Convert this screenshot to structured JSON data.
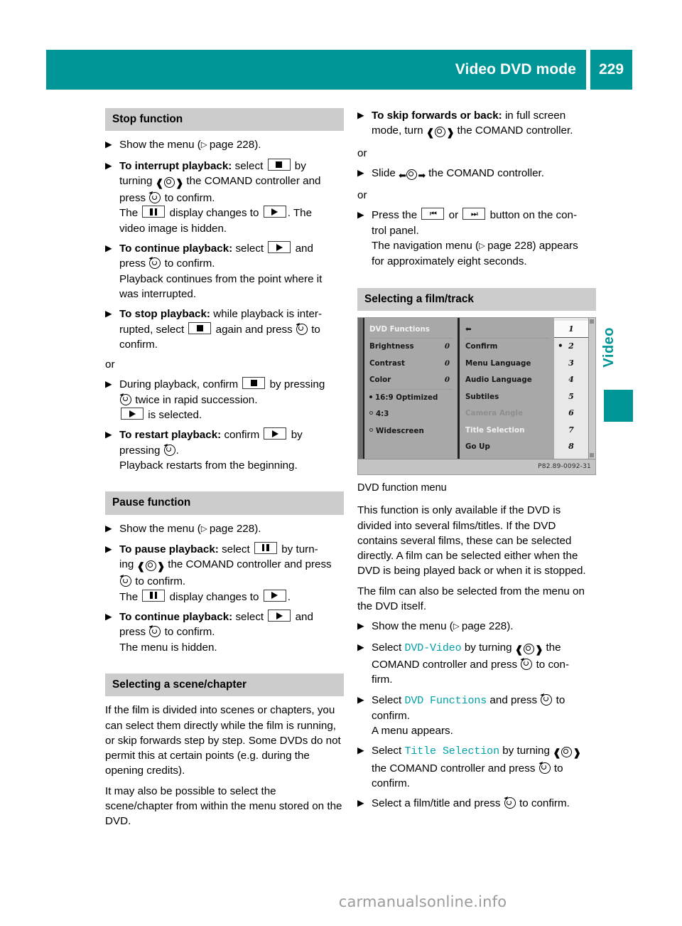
{
  "header": {
    "title": "Video DVD mode",
    "page_number": "229",
    "accent_color": "#009597"
  },
  "side_tab": {
    "label": "Video"
  },
  "left_column": {
    "sections": [
      {
        "heading": "Stop function",
        "blocks": [
          {
            "kind": "step",
            "id": "show-menu-1",
            "text_pre": "Show the menu (",
            "page_ref": "page 228",
            "text_post": ")."
          },
          {
            "kind": "step",
            "id": "interrupt-playback",
            "bold": "To interrupt playback:",
            "l1a": "select",
            "icon1": "stop-button",
            "l1b": "by",
            "l2a": "turning",
            "icon2": "comand-turn-knob",
            "l2b": "the COMAND controller and",
            "l3a": "press",
            "icon3": "comand-press",
            "l3b": "to confirm.",
            "l4a": "The",
            "icon4": "pause-button",
            "l4b": "display changes to",
            "icon5": "play-button",
            "l4c": ". The",
            "l5": "video image is hidden."
          },
          {
            "kind": "step",
            "id": "continue-playback-1",
            "bold": "To continue playback:",
            "l1a": "select",
            "icon1": "play-button",
            "l1b": "and",
            "l2a": "press",
            "icon2": "comand-press",
            "l2b": "to confirm.",
            "l3": "Playback continues from the point where it",
            "l4": "was interrupted."
          },
          {
            "kind": "step",
            "id": "stop-playback",
            "bold": "To stop playback:",
            "l1": "while playback is inter-",
            "l2a": "rupted, select",
            "icon1": "stop-button",
            "l2b": "again and press",
            "icon2": "comand-press",
            "l2c": "to",
            "l3": "confirm."
          },
          {
            "kind": "or",
            "text": "or"
          },
          {
            "kind": "step",
            "id": "during-playback-confirm",
            "l1a": "During playback, confirm",
            "icon1": "stop-button",
            "l1b": "by pressing",
            "l2a": "",
            "icon2": "comand-press",
            "l2b": "twice in rapid succession.",
            "icon3": "play-button",
            "l3b": "is selected."
          },
          {
            "kind": "step",
            "id": "restart-playback",
            "bold": "To restart playback:",
            "l1a": "confirm",
            "icon1": "play-button",
            "l1b": "by",
            "l2a": "pressing",
            "icon2": "comand-press",
            "l2b": ".",
            "l3": "Playback restarts from the beginning."
          }
        ]
      },
      {
        "heading": "Pause function",
        "blocks": [
          {
            "kind": "step",
            "id": "show-menu-2",
            "text_pre": "Show the menu (",
            "page_ref": "page 228",
            "text_post": ")."
          },
          {
            "kind": "step",
            "id": "pause-playback",
            "bold": "To pause playback:",
            "l1a": "select",
            "icon1": "pause-button",
            "l1b": "by turn-",
            "l2a": "ing",
            "icon2": "comand-turn-knob",
            "l2b": "the COMAND controller and press",
            "l3a": "",
            "icon3": "comand-press",
            "l3b": "to confirm.",
            "l4a": "The",
            "icon4": "pause-button",
            "l4b": "display changes to",
            "icon5": "play-button",
            "l4c": "."
          },
          {
            "kind": "step",
            "id": "continue-playback-2",
            "bold": "To continue playback:",
            "l1a": "select",
            "icon1": "play-button",
            "l1b": "and",
            "l2a": "press",
            "icon2": "comand-press",
            "l2b": "to confirm.",
            "l3": "The menu is hidden."
          }
        ]
      },
      {
        "heading": "Selecting a scene/chapter",
        "blocks": [
          {
            "kind": "para",
            "text": "If the film is divided into scenes or chapters, you can select them directly while the film is running, or skip forwards step by step. Some DVDs do not permit this at certain points (e.g. during the opening credits)."
          },
          {
            "kind": "para",
            "text": "It may also be possible to select the scene/chapter from within the menu stored on the DVD."
          }
        ]
      }
    ]
  },
  "right_column": {
    "top_steps": [
      {
        "id": "skip-forwards-back",
        "bold": "To skip forwards or back:",
        "l1": "in full screen",
        "l2a": "mode, turn",
        "icon1": "comand-turn-knob",
        "l2b": "the COMAND controller."
      },
      {
        "kind": "or",
        "text": "or"
      },
      {
        "id": "slide-controller",
        "l1a": "Slide",
        "icon1": "comand-slide",
        "l1b": "the COMAND controller."
      },
      {
        "kind": "or",
        "text": "or"
      },
      {
        "id": "press-skip-buttons",
        "l1a": "Press the",
        "icon1": "skip-back-button",
        "l1b": "or",
        "icon2": "skip-forward-button",
        "l1c": "button on the con-",
        "l2": "trol panel.",
        "l3a": "The navigation menu (",
        "page_ref": "page 228",
        "l3b": ") appears",
        "l4": "for approximately eight seconds."
      }
    ],
    "section": {
      "heading": "Selecting a film/track",
      "figure": {
        "caption": "DVD function menu",
        "code": "P82.89-0092-31",
        "column1": [
          {
            "label": "DVD Functions",
            "value": "",
            "style": "light",
            "separator_after": true
          },
          {
            "label": "Brightness",
            "value": "0"
          },
          {
            "label": "Contrast",
            "value": "0"
          },
          {
            "label": "Color",
            "value": "0",
            "separator_after": true
          },
          {
            "label": "16:9 Optimized",
            "value": "",
            "marker": "filled"
          },
          {
            "label": "4:3",
            "value": "",
            "marker": "hollow"
          },
          {
            "label": "Widescreen",
            "value": "",
            "marker": "hollow"
          }
        ],
        "column2": [
          {
            "label": "back-arrow",
            "is_icon": true,
            "separator_after": false
          },
          {
            "label": "Confirm",
            "separator_after": true
          },
          {
            "label": "Menu Language"
          },
          {
            "label": "Audio Language"
          },
          {
            "label": "Subtiles"
          },
          {
            "label": "Camera Angle",
            "style": "dim"
          },
          {
            "label": "Title Selection",
            "style": "light"
          },
          {
            "label": "Go Up"
          }
        ],
        "column3": [
          {
            "label": "1",
            "selected": true
          },
          {
            "label": "2",
            "marker": "dot"
          },
          {
            "label": "3"
          },
          {
            "label": "4"
          },
          {
            "label": "5"
          },
          {
            "label": "6"
          },
          {
            "label": "7"
          },
          {
            "label": "8"
          }
        ]
      },
      "paragraphs": [
        "This function is only available if the DVD is divided into several films/titles. If the DVD contains several films, these can be selected directly. A film can be selected either when the DVD is being played back or when it is stopped.",
        "The film can also be selected from the menu on the DVD itself."
      ],
      "steps": [
        {
          "id": "show-menu-3",
          "text_pre": "Show the menu (",
          "page_ref": "page 228",
          "text_post": ")."
        },
        {
          "id": "select-dvd-video",
          "l1a": "Select",
          "token": "DVD-Video",
          "l1b": "by turning",
          "icon1": "comand-turn-knob",
          "l1c": "the",
          "l2a": "COMAND controller and press",
          "icon2": "comand-press",
          "l2b": "to con-",
          "l3": "firm."
        },
        {
          "id": "select-dvd-functions",
          "l1a": "Select",
          "token": "DVD Functions",
          "l1b": "and press",
          "icon1": "comand-press",
          "l1c": "to",
          "l2": "confirm.",
          "l3": "A menu appears."
        },
        {
          "id": "select-title-selection",
          "l1a": "Select",
          "token": "Title Selection",
          "l1b": "by turning",
          "icon1": "comand-turn-knob",
          "l2a": "the COMAND controller and press",
          "icon2": "comand-press",
          "l2b": "to",
          "l3": "confirm."
        },
        {
          "id": "select-film-title",
          "l1a": "Select a film/title and press",
          "icon1": "comand-press",
          "l1b": "to confirm."
        }
      ]
    }
  },
  "footer": {
    "text": "carmanualsonline.info"
  }
}
